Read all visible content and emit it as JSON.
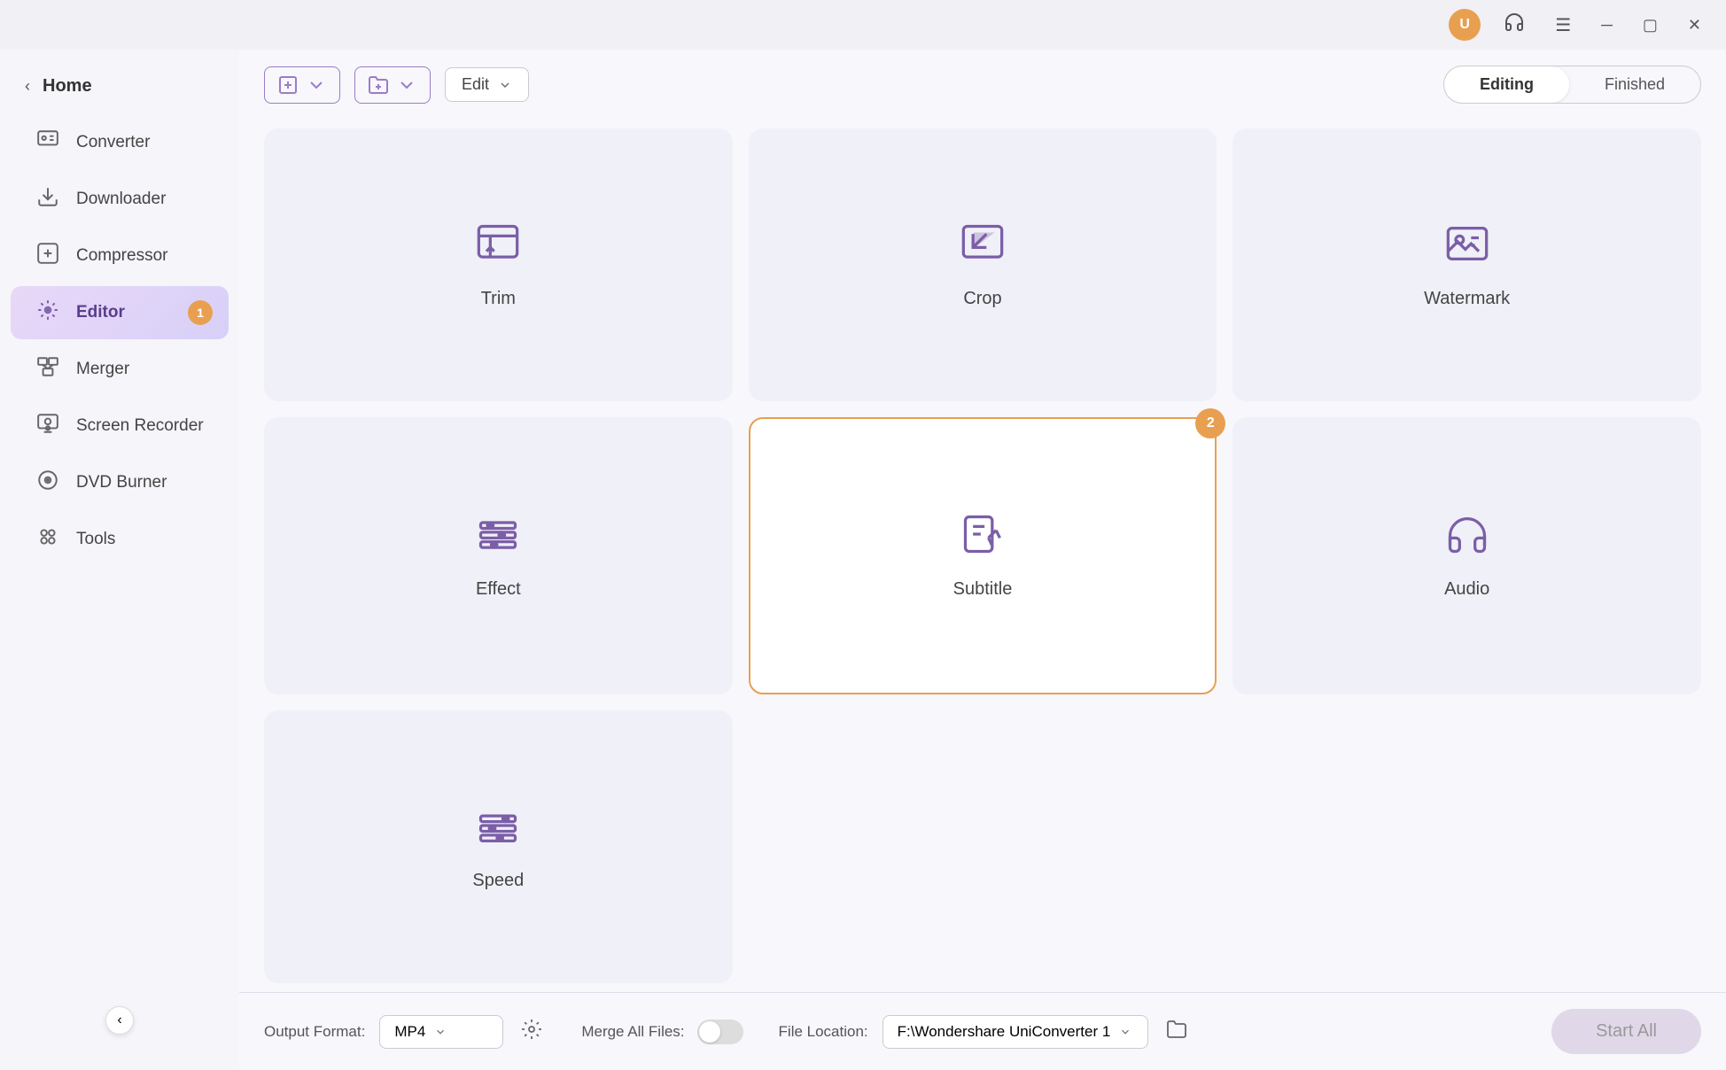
{
  "titlebar": {
    "user_icon_label": "U",
    "headphone_icon": "headphone-icon",
    "menu_icon": "menu-icon",
    "minimize_icon": "minimize-icon",
    "maximize_icon": "maximize-icon",
    "close_icon": "close-icon"
  },
  "sidebar": {
    "home_label": "Home",
    "items": [
      {
        "id": "converter",
        "label": "Converter",
        "icon": "converter-icon"
      },
      {
        "id": "downloader",
        "label": "Downloader",
        "icon": "downloader-icon"
      },
      {
        "id": "compressor",
        "label": "Compressor",
        "icon": "compressor-icon"
      },
      {
        "id": "editor",
        "label": "Editor",
        "icon": "editor-icon",
        "active": true,
        "badge": "1"
      },
      {
        "id": "merger",
        "label": "Merger",
        "icon": "merger-icon"
      },
      {
        "id": "screen-recorder",
        "label": "Screen Recorder",
        "icon": "screen-recorder-icon"
      },
      {
        "id": "dvd-burner",
        "label": "DVD Burner",
        "icon": "dvd-burner-icon"
      },
      {
        "id": "tools",
        "label": "Tools",
        "icon": "tools-icon"
      }
    ]
  },
  "toolbar": {
    "add_file_label": "add-file",
    "add_folder_label": "add-folder",
    "edit_dropdown_value": "Edit",
    "edit_dropdown_placeholder": "Edit",
    "tab_editing": "Editing",
    "tab_finished": "Finished"
  },
  "editor": {
    "cards": [
      {
        "id": "trim",
        "label": "Trim"
      },
      {
        "id": "crop",
        "label": "Crop"
      },
      {
        "id": "watermark",
        "label": "Watermark"
      },
      {
        "id": "effect",
        "label": "Effect"
      },
      {
        "id": "subtitle",
        "label": "Subtitle",
        "badge": "2",
        "highlighted": true
      },
      {
        "id": "audio",
        "label": "Audio"
      },
      {
        "id": "speed",
        "label": "Speed"
      }
    ]
  },
  "bottombar": {
    "output_format_label": "Output Format:",
    "output_format_value": "MP4",
    "file_location_label": "File Location:",
    "file_location_value": "F:\\Wondershare UniConverter 1",
    "merge_all_label": "Merge All Files:",
    "start_all_label": "Start All"
  }
}
